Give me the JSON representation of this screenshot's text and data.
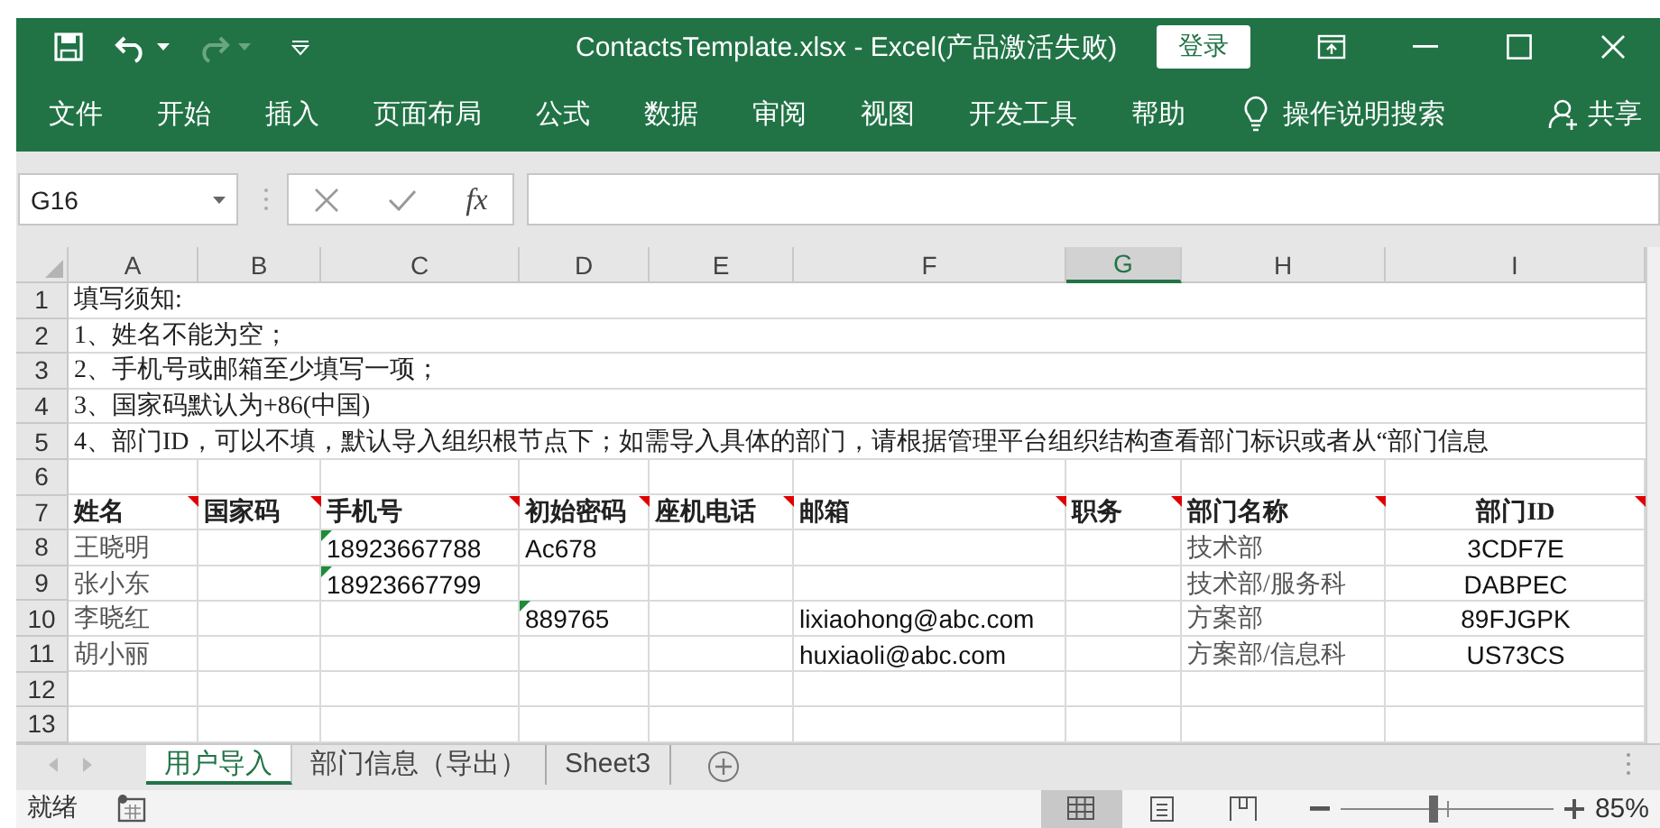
{
  "window": {
    "title": "ContactsTemplate.xlsx - Excel(产品激活失败)",
    "sign_in_button": "登录"
  },
  "quick_access": {
    "undo": {
      "disabled": false
    },
    "redo": {
      "disabled": true
    }
  },
  "ribbon_tabs": [
    {
      "label": "文件"
    },
    {
      "label": "开始"
    },
    {
      "label": "插入"
    },
    {
      "label": "页面布局"
    },
    {
      "label": "公式"
    },
    {
      "label": "数据"
    },
    {
      "label": "审阅"
    },
    {
      "label": "视图"
    },
    {
      "label": "开发工具"
    },
    {
      "label": "帮助"
    }
  ],
  "tell_me": "操作说明搜索",
  "share": "共享",
  "formula_bar": {
    "name_box": "G16",
    "function_label": "fx"
  },
  "sheet": {
    "columns": [
      {
        "label": "A",
        "selected": false
      },
      {
        "label": "B",
        "selected": false
      },
      {
        "label": "C",
        "selected": false
      },
      {
        "label": "D",
        "selected": false
      },
      {
        "label": "E",
        "selected": false
      },
      {
        "label": "F",
        "selected": false
      },
      {
        "label": "G",
        "selected": true
      },
      {
        "label": "H",
        "selected": false
      },
      {
        "label": "I",
        "selected": false
      }
    ],
    "rows": [
      {
        "number": "1",
        "kind": "note",
        "text": "填写须知:"
      },
      {
        "number": "2",
        "kind": "note",
        "text": "1、姓名不能为空；"
      },
      {
        "number": "3",
        "kind": "note",
        "text": "2、手机号或邮箱至少填写一项；"
      },
      {
        "number": "4",
        "kind": "note",
        "text": "3、国家码默认为+86(中国)"
      },
      {
        "number": "5",
        "kind": "note",
        "text": "4、部门ID，可以不填，默认导入组织根节点下；如需导入具体的部门，请根据管理平台组织结构查看部门标识或者从“部门信息"
      },
      {
        "number": "6",
        "kind": "blank"
      },
      {
        "number": "7",
        "kind": "header",
        "cells": [
          {
            "text": "姓名",
            "comment": true
          },
          {
            "text": "国家码",
            "comment": true
          },
          {
            "text": "手机号",
            "comment": true
          },
          {
            "text": "初始密码",
            "comment": true
          },
          {
            "text": "座机电话",
            "comment": true
          },
          {
            "text": "邮箱",
            "comment": true
          },
          {
            "text": "职务",
            "comment": true
          },
          {
            "text": "部门名称",
            "comment": true
          },
          {
            "text": "部门ID",
            "comment": true
          }
        ]
      },
      {
        "number": "8",
        "kind": "data",
        "cells": [
          {
            "text": "王晓明",
            "warning": false
          },
          null,
          {
            "text": "18923667788",
            "warning": true
          },
          {
            "text": "Ac678",
            "warning": false
          },
          null,
          null,
          null,
          {
            "text": "技术部",
            "warning": false
          },
          {
            "text": "3CDF7E",
            "warning": false
          }
        ]
      },
      {
        "number": "9",
        "kind": "data",
        "cells": [
          {
            "text": "张小东",
            "warning": false
          },
          null,
          {
            "text": "18923667799",
            "warning": true
          },
          null,
          null,
          null,
          null,
          {
            "text": "技术部/服务科",
            "warning": false
          },
          {
            "text": "DABPEC",
            "warning": false
          }
        ]
      },
      {
        "number": "10",
        "kind": "data",
        "cells": [
          {
            "text": "李晓红",
            "warning": false
          },
          null,
          null,
          {
            "text": "889765",
            "warning": true
          },
          null,
          {
            "text": "lixiaohong@abc.com",
            "warning": false
          },
          null,
          {
            "text": "方案部",
            "warning": false
          },
          {
            "text": "89FJGPK",
            "warning": false
          }
        ]
      },
      {
        "number": "11",
        "kind": "data",
        "cells": [
          {
            "text": "胡小丽",
            "warning": false
          },
          null,
          null,
          null,
          null,
          {
            "text": "huxiaoli@abc.com",
            "warning": false
          },
          null,
          {
            "text": "方案部/信息科",
            "warning": false
          },
          {
            "text": "US73CS",
            "warning": false
          }
        ]
      },
      {
        "number": "12",
        "kind": "blank"
      },
      {
        "number": "13",
        "kind": "blank"
      }
    ]
  },
  "sheet_tabs": [
    {
      "label": "用户导入",
      "selected": true
    },
    {
      "label": "部门信息（导出）",
      "selected": false
    },
    {
      "label": "Sheet3",
      "selected": false
    }
  ],
  "status_bar": {
    "text": "就绪",
    "views": [
      {
        "kind": "normal",
        "selected": true
      },
      {
        "kind": "page_layout",
        "selected": false
      },
      {
        "kind": "page_break",
        "selected": false
      }
    ],
    "zoom": {
      "level": 0.43,
      "reading": "85%"
    }
  }
}
